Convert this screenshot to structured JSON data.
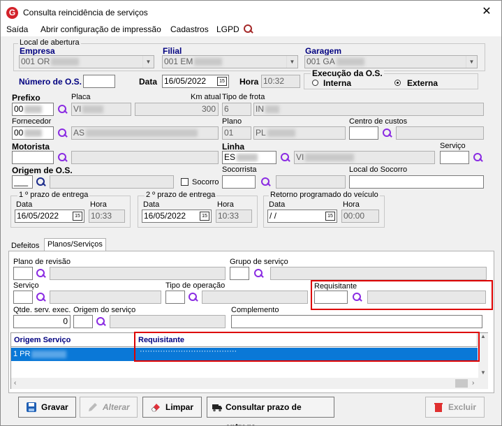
{
  "window": {
    "title": "Consulta reincidência de serviços",
    "close": "✕"
  },
  "menu": [
    "Saída",
    "Abrir configuração de impressão",
    "Cadastros",
    "LGPD"
  ],
  "abertura": {
    "legend": "Local de abertura",
    "empresa_label": "Empresa",
    "empresa": "001 OR",
    "filial_label": "Filial",
    "filial": "001 EM",
    "garagem_label": "Garagem",
    "garagem": "001 GA"
  },
  "os": {
    "numero_label": "Número de O.S.",
    "numero": "",
    "data_label": "Data",
    "data": "16/05/2022",
    "hora_label": "Hora",
    "hora": "10:32"
  },
  "execucao": {
    "legend": "Execução da O.S.",
    "interna": "Interna",
    "externa": "Externa"
  },
  "prefixo": {
    "label": "Prefixo",
    "value": "00",
    "placa_label": "Placa",
    "placa": "VI",
    "km_label": "Km atual",
    "km": "300",
    "frota_label": "Tipo de frota",
    "frota_code": "6",
    "frota": "IN"
  },
  "fornecedor": {
    "label": "Fornecedor",
    "value": "00",
    "name": "AS",
    "plano_label": "Plano",
    "plano_code": "01",
    "plano": "PL",
    "cc_label": "Centro de custos"
  },
  "motorista": {
    "label": "Motorista",
    "linha_label": "Linha",
    "linha_code": "ES",
    "linha": "VI",
    "servico_label": "Serviço"
  },
  "origem": {
    "label": "Origem de O.S.",
    "value": "___",
    "socorro": "Socorro",
    "socorrista_label": "Socorrista",
    "local_label": "Local do Socorro"
  },
  "prazo1": {
    "legend": "1 º prazo de entrega",
    "data_label": "Data",
    "data": "16/05/2022",
    "hora_label": "Hora",
    "hora": "10:33"
  },
  "prazo2": {
    "legend": "2 º prazo de entrega",
    "data_label": "Data",
    "data": "16/05/2022",
    "hora_label": "Hora",
    "hora": "10:33"
  },
  "retorno": {
    "legend": "Retorno programado do veículo",
    "data_label": "Data",
    "data": " / /",
    "hora_label": "Hora",
    "hora": "00:00"
  },
  "tabs": [
    "Defeitos",
    "Planos/Serviços"
  ],
  "planos": {
    "revisao_label": "Plano de revisão",
    "grupo_label": "Grupo de serviço",
    "servico_label": "Serviço",
    "tipo_op_label": "Tipo de operação",
    "requisitante_label": "Requisitante",
    "qtde_label": "Qtde. serv. exec.",
    "qtde": "0",
    "origem_label": "Origem do serviço",
    "complemento_label": "Complemento"
  },
  "grid": {
    "headers": [
      "Origem Serviço",
      "Requisitante"
    ],
    "row": {
      "origem": "1 PR",
      "requisitante": "······································"
    }
  },
  "buttons": {
    "gravar": "Gravar",
    "alterar": "Alterar",
    "limpar": "Limpar",
    "consultar": "Consultar prazo de entrega",
    "excluir": "Excluir"
  }
}
